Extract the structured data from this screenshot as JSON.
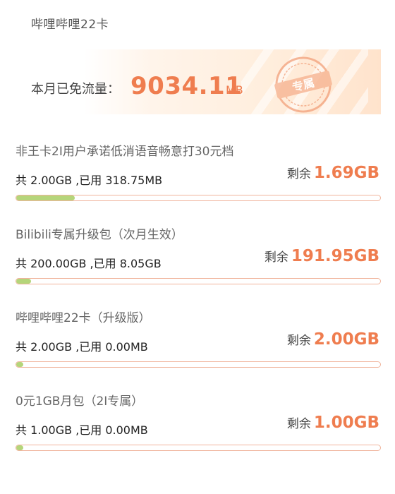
{
  "card": {
    "title": "哔哩哔哩22卡"
  },
  "free_traffic": {
    "label": "本月已免流量：",
    "value": "9034.11",
    "unit": "MB",
    "stamp_text": "专属"
  },
  "packages": [
    {
      "name": "非王卡2I用户承诺低消语音畅意打30元档",
      "usage": "共 2.00GB ,已用 318.75MB",
      "remain_label": "剩余",
      "remain_value": "1.69GB",
      "used_fraction": 0.16
    },
    {
      "name": "Bilibili专属升级包（次月生效）",
      "usage": "共 200.00GB ,已用 8.05GB",
      "remain_label": "剩余",
      "remain_value": "191.95GB",
      "used_fraction": 0.04
    },
    {
      "name": "哔哩哔哩22卡（升级版）",
      "usage": "共 2.00GB ,已用 0.00MB",
      "remain_label": "剩余",
      "remain_value": "2.00GB",
      "used_fraction": 0.0
    },
    {
      "name": "0元1GB月包（2I专属）",
      "usage": "共 1.00GB ,已用 0.00MB",
      "remain_label": "剩余",
      "remain_value": "1.00GB",
      "used_fraction": 0.0
    }
  ],
  "colors": {
    "accent": "#ef7d4f",
    "bar_fill": "#b5d57a",
    "bar_border": "#f0b49c"
  }
}
